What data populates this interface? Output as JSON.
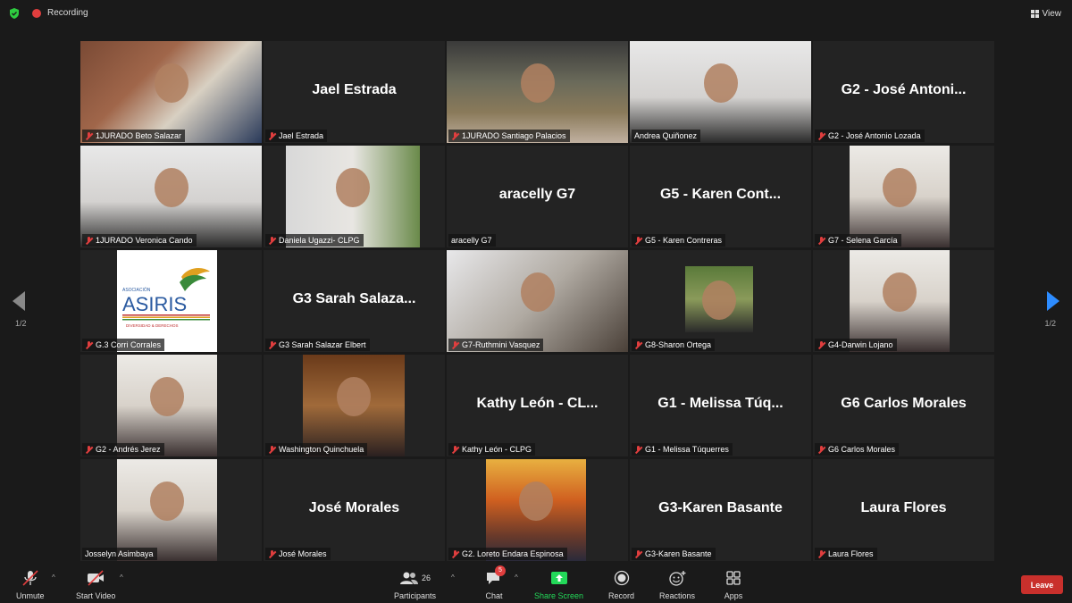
{
  "topbar": {
    "recording_label": "Recording",
    "view_label": "View",
    "colors": {
      "shield": "#2ecc40",
      "recording": "#e03e3e"
    }
  },
  "gallery": {
    "page_left": "1/2",
    "page_right": "1/2",
    "tiles": [
      {
        "label": "1JURADO Beto Salazar",
        "big": "",
        "muted": true,
        "video": "office"
      },
      {
        "label": "Jael Estrada",
        "big": "Jael Estrada",
        "muted": true,
        "video": ""
      },
      {
        "label": "1JURADO Santiago Palacios",
        "big": "",
        "muted": true,
        "video": "shop"
      },
      {
        "label": "Andrea Quiñonez",
        "big": "",
        "muted": false,
        "video": "light",
        "active": true
      },
      {
        "label": "G2 - José Antonio Lozada",
        "big": "G2 - José Antoni...",
        "muted": true,
        "video": ""
      },
      {
        "label": "1JURADO Veronica Cando",
        "big": "",
        "muted": true,
        "video": "light"
      },
      {
        "label": "Daniela Ugazzi- CLPG",
        "big": "",
        "muted": true,
        "video": "room"
      },
      {
        "label": "aracelly G7",
        "big": "aracelly G7",
        "muted": false,
        "video": ""
      },
      {
        "label": "G5 - Karen Contreras",
        "big": "G5 - Karen Cont...",
        "muted": true,
        "video": ""
      },
      {
        "label": "G7 - Selena García",
        "big": "",
        "muted": true,
        "video": "portrait"
      },
      {
        "label": "G.3 Corri Corrales",
        "big": "",
        "muted": true,
        "video": "logo"
      },
      {
        "label": "G3 Sarah Salazar Elbert",
        "big": "G3 Sarah Salaza...",
        "muted": true,
        "video": ""
      },
      {
        "label": "G7-Ruthmini Vasquez",
        "big": "",
        "muted": true,
        "video": "wide"
      },
      {
        "label": "G8-Sharon Ortega",
        "big": "",
        "muted": true,
        "video": "small"
      },
      {
        "label": "G4-Darwin Lojano",
        "big": "",
        "muted": true,
        "video": "portrait"
      },
      {
        "label": "G2 - Andrés Jerez",
        "big": "",
        "muted": true,
        "video": "portrait"
      },
      {
        "label": "Washington Quinchuela",
        "big": "",
        "muted": true,
        "video": "warm"
      },
      {
        "label": "Kathy León - CLPG",
        "big": "Kathy León - CL...",
        "muted": true,
        "video": ""
      },
      {
        "label": "G1 - Melissa Túquerres",
        "big": "G1 - Melissa Túq...",
        "muted": true,
        "video": ""
      },
      {
        "label": "G6 Carlos Morales",
        "big": "G6 Carlos Morales",
        "muted": true,
        "video": ""
      },
      {
        "label": "Josselyn Asimbaya",
        "big": "",
        "muted": false,
        "video": "portrait"
      },
      {
        "label": "José Morales",
        "big": "José Morales",
        "muted": true,
        "video": ""
      },
      {
        "label": "G2. Loreto Endara Espinosa",
        "big": "",
        "muted": true,
        "video": "painting"
      },
      {
        "label": "G3-Karen Basante",
        "big": "G3-Karen Basante",
        "muted": true,
        "video": ""
      },
      {
        "label": "Laura Flores",
        "big": "Laura Flores",
        "muted": true,
        "video": ""
      }
    ],
    "logo_text": {
      "top": "ASOCIACIÓN",
      "main": "ASIRIS",
      "sub": "DIVERSIDAD & DERECHOS"
    }
  },
  "toolbar": {
    "unmute": "Unmute",
    "start_video": "Start Video",
    "participants": "Participants",
    "participants_count": "26",
    "chat": "Chat",
    "chat_badge": "5",
    "share_screen": "Share Screen",
    "record": "Record",
    "reactions": "Reactions",
    "apps": "Apps",
    "leave": "Leave",
    "colors": {
      "share": "#23d959",
      "leave": "#c9302c"
    }
  }
}
